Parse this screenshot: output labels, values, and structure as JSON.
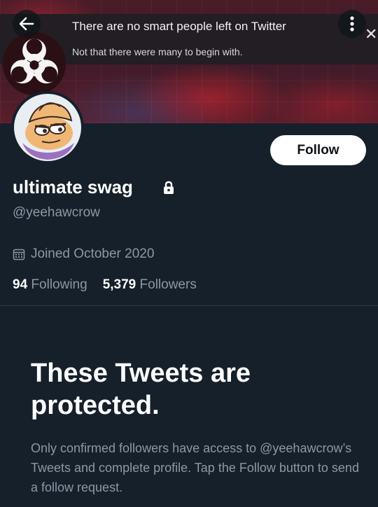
{
  "banner": {
    "meme_line1": "There are no smart people left on Twitter",
    "meme_line2": "Not that there were many to begin with."
  },
  "header": {
    "back_icon": "arrow-left-icon",
    "more_icon": "more-vertical-icon",
    "close_icon": "close-icon",
    "close_glyph": "✕"
  },
  "profile": {
    "display_name": "ultimate swag",
    "handle": "@yeehawcrow",
    "joined": "Joined October 2020",
    "following_count": "94",
    "following_label": "Following",
    "followers_count": "5,379",
    "followers_label": "Followers",
    "follow_button": "Follow"
  },
  "protected": {
    "title": "These Tweets are protected.",
    "body": "Only confirmed followers have access to @yeehawcrow’s Tweets and complete profile. Tap the Follow button to send a follow request."
  },
  "colors": {
    "background": "#15202b",
    "secondary_text": "#8b98a5",
    "button_bg": "#ffffff"
  }
}
